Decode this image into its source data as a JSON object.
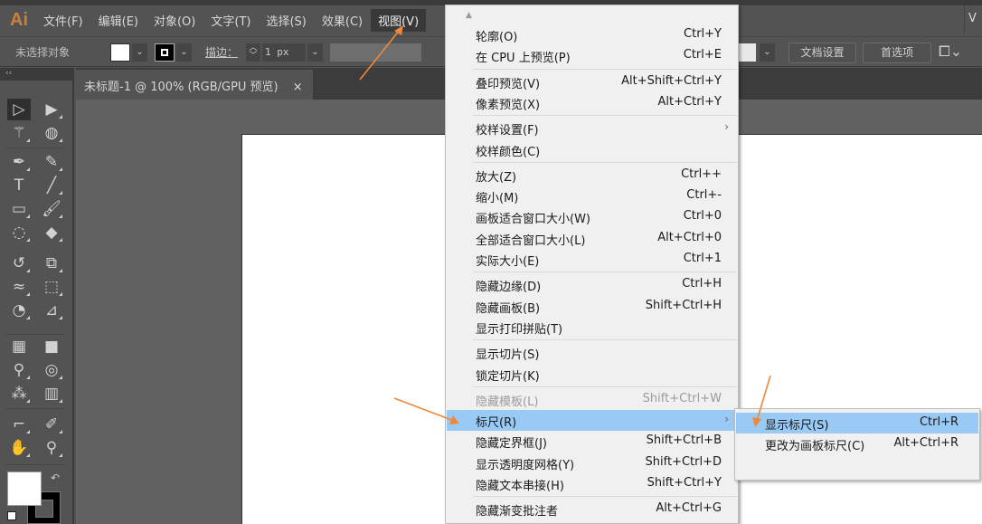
{
  "app": {
    "logo": "Ai"
  },
  "menubar": {
    "items": [
      {
        "label": "文件(F)"
      },
      {
        "label": "编辑(E)"
      },
      {
        "label": "对象(O)"
      },
      {
        "label": "文字(T)"
      },
      {
        "label": "选择(S)"
      },
      {
        "label": "效果(C)"
      },
      {
        "label": "视图(V)",
        "active": true
      }
    ],
    "right_fragment": "V"
  },
  "controlbar": {
    "selection_status": "未选择对象",
    "stroke_label": "描边：",
    "stroke_weight": "1 px",
    "doc_settings_button": "文档设置",
    "preferences_button": "首选项",
    "chevron": "⌄"
  },
  "toolbar": {
    "collapse": "‹‹",
    "tools": [
      {
        "name": "selection-tool",
        "glyph": "▷",
        "selected": true
      },
      {
        "name": "direct-selection-tool",
        "glyph": "▶"
      },
      {
        "name": "magic-wand-tool",
        "glyph": "⚚"
      },
      {
        "name": "lasso-tool",
        "glyph": "◍"
      },
      {
        "name": "pen-tool",
        "glyph": "✒"
      },
      {
        "name": "curvature-tool",
        "glyph": "✎"
      },
      {
        "name": "type-tool",
        "glyph": "T"
      },
      {
        "name": "line-segment-tool",
        "glyph": "╱"
      },
      {
        "name": "rectangle-tool",
        "glyph": "▭"
      },
      {
        "name": "paintbrush-tool",
        "glyph": "🖌"
      },
      {
        "name": "shaper-tool",
        "glyph": "◌"
      },
      {
        "name": "eraser-tool",
        "glyph": "◆"
      },
      {
        "name": "rotate-tool",
        "glyph": "↺"
      },
      {
        "name": "scale-tool",
        "glyph": "⧉"
      },
      {
        "name": "warp-tool",
        "glyph": "≈"
      },
      {
        "name": "free-transform-tool",
        "glyph": "⬚"
      },
      {
        "name": "shape-builder-tool",
        "glyph": "◔"
      },
      {
        "name": "perspective-grid-tool",
        "glyph": "⊿"
      },
      {
        "name": "mesh-tool",
        "glyph": "▦"
      },
      {
        "name": "gradient-tool",
        "glyph": "■"
      },
      {
        "name": "eyedropper-tool",
        "glyph": "⚲"
      },
      {
        "name": "blend-tool",
        "glyph": "◎"
      },
      {
        "name": "symbol-sprayer-tool",
        "glyph": "⁂"
      },
      {
        "name": "column-graph-tool",
        "glyph": "▥"
      },
      {
        "name": "artboard-tool",
        "glyph": "⌐"
      },
      {
        "name": "slice-tool",
        "glyph": "✐"
      },
      {
        "name": "hand-tool",
        "glyph": "✋"
      },
      {
        "name": "zoom-tool",
        "glyph": "⚲"
      }
    ],
    "swap_icon": "↶",
    "colors": {
      "fill": "#ffffff",
      "stroke": "#000000"
    }
  },
  "document_tab": {
    "title": "未标题-1 @ 100% (RGB/GPU 预览)",
    "close": "×"
  },
  "view_menu": {
    "scroll_up": "▲",
    "groups": [
      [
        {
          "label": "轮廓(O)",
          "shortcut": "Ctrl+Y"
        },
        {
          "label": "在 CPU 上预览(P)",
          "shortcut": "Ctrl+E"
        }
      ],
      [
        {
          "label": "叠印预览(V)",
          "shortcut": "Alt+Shift+Ctrl+Y"
        },
        {
          "label": "像素预览(X)",
          "shortcut": "Alt+Ctrl+Y"
        }
      ],
      [
        {
          "label": "校样设置(F)",
          "shortcut": "",
          "submenu": true
        },
        {
          "label": "校样颜色(C)",
          "shortcut": ""
        }
      ],
      [
        {
          "label": "放大(Z)",
          "shortcut": "Ctrl++"
        },
        {
          "label": "缩小(M)",
          "shortcut": "Ctrl+-"
        },
        {
          "label": "画板适合窗口大小(W)",
          "shortcut": "Ctrl+0"
        },
        {
          "label": "全部适合窗口大小(L)",
          "shortcut": "Alt+Ctrl+0"
        },
        {
          "label": "实际大小(E)",
          "shortcut": "Ctrl+1"
        }
      ],
      [
        {
          "label": "隐藏边缘(D)",
          "shortcut": "Ctrl+H"
        },
        {
          "label": "隐藏画板(B)",
          "shortcut": "Shift+Ctrl+H"
        },
        {
          "label": "显示打印拼贴(T)",
          "shortcut": ""
        }
      ],
      [
        {
          "label": "显示切片(S)",
          "shortcut": ""
        },
        {
          "label": "锁定切片(K)",
          "shortcut": ""
        }
      ],
      [
        {
          "label": "隐藏模板(L)",
          "shortcut": "Shift+Ctrl+W",
          "disabled": true
        },
        {
          "label": "标尺(R)",
          "shortcut": "",
          "submenu": true,
          "highlight": true
        },
        {
          "label": "隐藏定界框(J)",
          "shortcut": "Shift+Ctrl+B"
        },
        {
          "label": "显示透明度网格(Y)",
          "shortcut": "Shift+Ctrl+D"
        },
        {
          "label": "隐藏文本串接(H)",
          "shortcut": "Shift+Ctrl+Y"
        }
      ],
      [
        {
          "label": "隐藏渐变批注者",
          "shortcut": "Alt+Ctrl+G"
        }
      ]
    ],
    "submenu_arrow": "›"
  },
  "ruler_submenu": {
    "items": [
      {
        "label": "显示标尺(S)",
        "shortcut": "Ctrl+R",
        "highlight": true
      },
      {
        "label": "更改为画板标尺(C)",
        "shortcut": "Alt+Ctrl+R"
      }
    ]
  },
  "annotation": {
    "arrow_color": "#f0883a"
  },
  "colors": {
    "menu_highlight": "#99c9f5",
    "ui_dark": "#535353",
    "canvas": "#616161"
  }
}
